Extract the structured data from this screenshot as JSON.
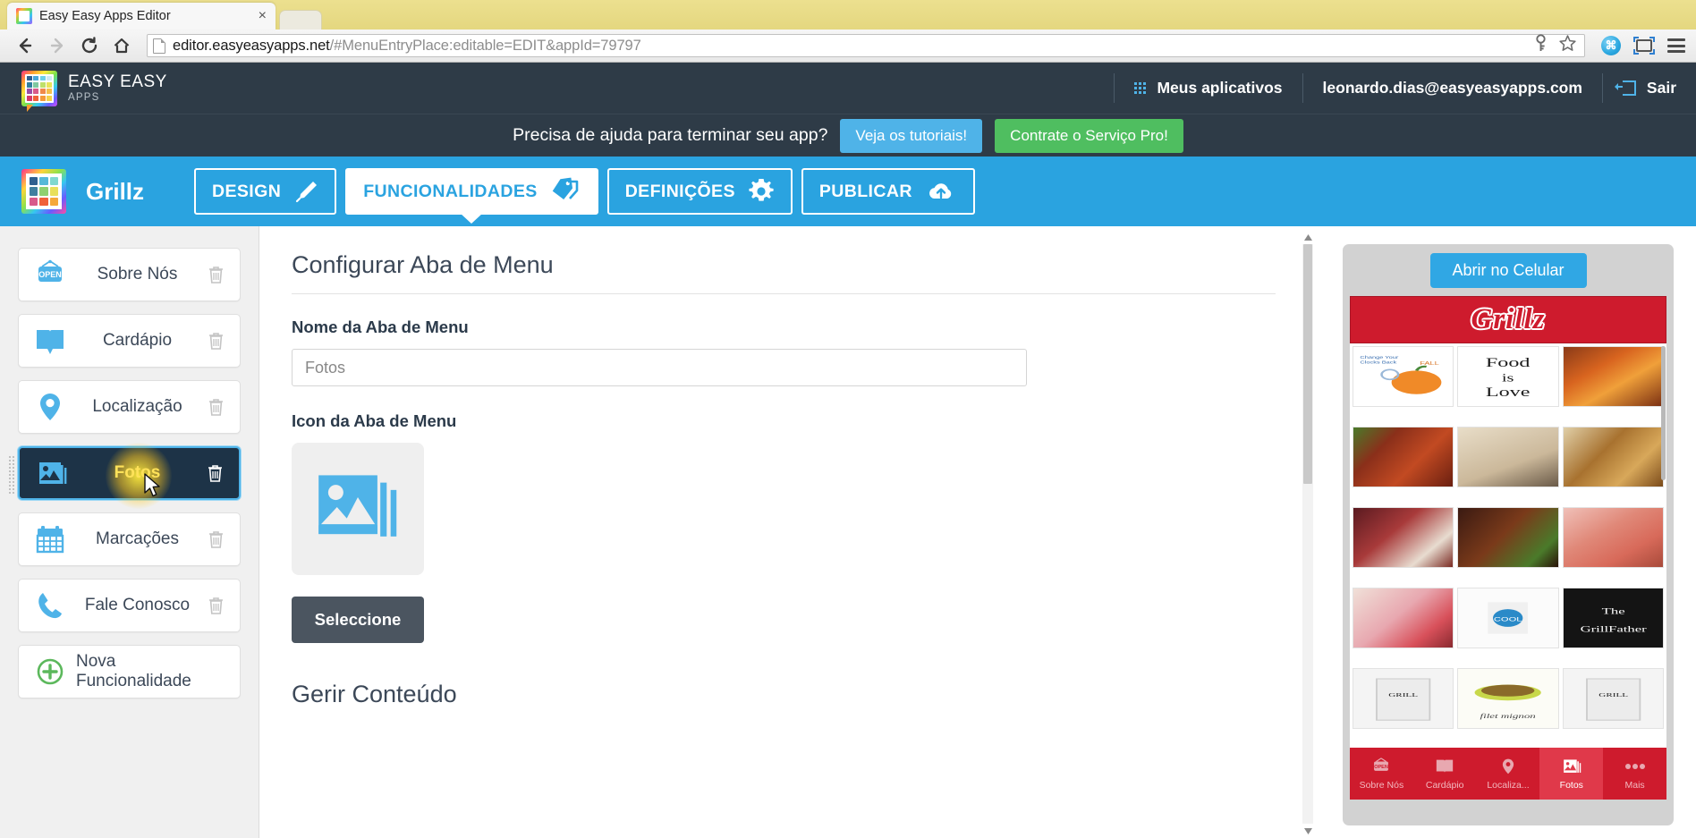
{
  "browser": {
    "tab_title": "Easy Easy Apps Editor",
    "tab_close": "×",
    "url_domain": "editor.easyeasyapps.net",
    "url_path": "/#MenuEntryPlace:editable=EDIT&appId=79797"
  },
  "topnav": {
    "logo_line1": "EASY EASY",
    "logo_line2": "APPS",
    "my_apps": "Meus aplicativos",
    "account_email": "leonardo.dias@easyeasyapps.com",
    "logout": "Sair"
  },
  "promo": {
    "text": "Precisa de ajuda para terminar seu app?",
    "tutorials_button": "Veja os tutoriais!",
    "pro_button": "Contrate o Serviço Pro!",
    "tutorials_color": "#4fb3e8",
    "pro_color": "#4fbe60"
  },
  "appbar": {
    "app_name": "Grillz",
    "tabs": [
      {
        "label": "DESIGN",
        "icon": "brush-icon",
        "active": false
      },
      {
        "label": "FUNCIONALIDADES",
        "icon": "tags-icon",
        "active": true
      },
      {
        "label": "DEFINIÇÕES",
        "icon": "gear-icon",
        "active": false
      },
      {
        "label": "PUBLICAR",
        "icon": "cloud-upload-icon",
        "active": false
      }
    ],
    "accent_color": "#2aa3e0"
  },
  "sidebar": {
    "items": [
      {
        "label": "Sobre Nós",
        "icon": "open-sign-icon",
        "selected": false
      },
      {
        "label": "Cardápio",
        "icon": "open-book-icon",
        "selected": false
      },
      {
        "label": "Localização",
        "icon": "map-pin-icon",
        "selected": false
      },
      {
        "label": "Fotos",
        "icon": "photos-stack-icon",
        "selected": true
      },
      {
        "label": "Marcações",
        "icon": "calendar-icon",
        "selected": false
      },
      {
        "label": "Fale Conosco",
        "icon": "phone-icon",
        "selected": false
      }
    ],
    "new_feature": {
      "label": "Nova Funcionalidade",
      "icon": "plus-circle-icon"
    },
    "selected_label_color": "#ffe259"
  },
  "main": {
    "title": "Configurar Aba de Menu",
    "name_label": "Nome da Aba de Menu",
    "name_value": "Fotos",
    "icon_label": "Icon da Aba de Menu",
    "icon_name": "photos-stack-icon",
    "select_button": "Seleccione",
    "content_title": "Gerir Conteúdo"
  },
  "preview": {
    "open_button": "Abrir no Celular",
    "app_logo": "Grillz",
    "header_color": "#ce1b2d",
    "photos": [
      "pumpkin-clipart",
      "food-is-love-text",
      "grilled-platter",
      "bbq-ribs-salad",
      "soup-bowl",
      "chopped-bbq-plate",
      "dessert-cream",
      "marinated-meat",
      "sliced-ham",
      "strawberry-dessert",
      "cool-tshirt",
      "grillfather-apron",
      "apron-print-1",
      "filet-mignon",
      "apron-print-2"
    ],
    "nav": [
      {
        "label": "Sobre Nós",
        "icon": "open-sign-icon",
        "active": false
      },
      {
        "label": "Cardápio",
        "icon": "open-book-icon",
        "active": false
      },
      {
        "label": "Localiza...",
        "icon": "map-pin-icon",
        "active": false
      },
      {
        "label": "Fotos",
        "icon": "photos-stack-icon",
        "active": true
      },
      {
        "label": "Mais",
        "icon": "ellipsis-icon",
        "active": false
      }
    ]
  }
}
